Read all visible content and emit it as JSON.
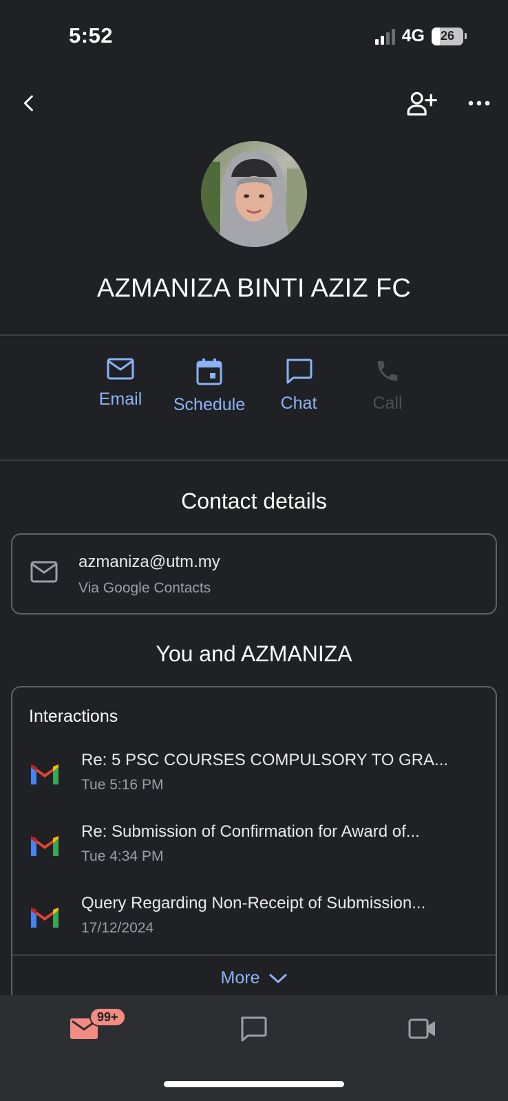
{
  "status_bar": {
    "time": "5:52",
    "network": "4G",
    "battery_level": "26"
  },
  "topbar": {
    "back_icon": "chevron-left-icon",
    "add_contact_icon": "person-add-icon",
    "more_icon": "more-horizontal-icon"
  },
  "contact": {
    "name": "AZMANIZA BINTI AZIZ FC"
  },
  "actions": [
    {
      "label": "Email",
      "icon": "mail-icon",
      "enabled": true
    },
    {
      "label": "Schedule",
      "icon": "calendar-icon",
      "enabled": true
    },
    {
      "label": "Chat",
      "icon": "chat-icon",
      "enabled": true
    },
    {
      "label": "Call",
      "icon": "phone-icon",
      "enabled": false
    }
  ],
  "contact_details": {
    "title": "Contact details",
    "email": "azmaniza@utm.my",
    "source": "Via Google Contacts"
  },
  "you_and": {
    "title": "You and AZMANIZA",
    "heading": "Interactions",
    "items": [
      {
        "subject": "Re: 5 PSC COURSES COMPULSORY TO GRA...",
        "date": "Tue 5:16 PM"
      },
      {
        "subject": "Re: Submission of Confirmation for Award of...",
        "date": "Tue 4:34 PM"
      },
      {
        "subject": "Query Regarding Non-Receipt of Submission...",
        "date": "17/12/2024"
      }
    ],
    "more_label": "More"
  },
  "bottom_nav": {
    "mail_badge": "99+",
    "items": [
      "mail-icon",
      "chat-icon",
      "video-icon"
    ]
  },
  "colors": {
    "background": "#202124",
    "accent": "#8ab4f8",
    "mail_active": "#f28b82",
    "disabled": "#4d5054"
  }
}
